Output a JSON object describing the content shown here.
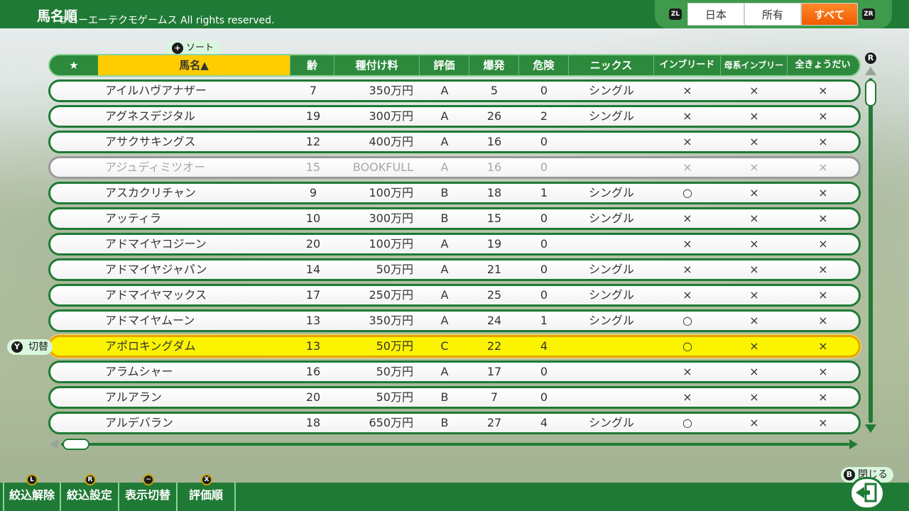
{
  "topbar": {
    "title": "馬名順",
    "copyright": "©コーエーテクモゲームス All rights reserved.",
    "zl_label": "ZL",
    "zr_label": "ZR",
    "filters": [
      {
        "label": "日本",
        "active": false
      },
      {
        "label": "所有",
        "active": false
      },
      {
        "label": "すべて",
        "active": true
      }
    ]
  },
  "sort_hint": {
    "button": "+",
    "label": "ソート"
  },
  "table": {
    "headers": {
      "star": "★",
      "name": "馬名▲",
      "age": "齢",
      "fee": "種付け料",
      "eval": "評価",
      "boom": "爆発",
      "risk": "危険",
      "nicks": "ニックス",
      "inbreed": "インブリード",
      "dam_inbreed": "母系インブリード",
      "siblings": "全きょうだい"
    },
    "rows": [
      {
        "name": "アイルハヴアナザー",
        "age": "7",
        "fee": "350万円",
        "eval": "A",
        "boom": "5",
        "risk": "0",
        "nicks": "シングル",
        "inbreed": "×",
        "dam_inbreed": "×",
        "siblings": "×"
      },
      {
        "name": "アグネスデジタル",
        "age": "19",
        "fee": "300万円",
        "eval": "A",
        "boom": "26",
        "risk": "2",
        "nicks": "シングル",
        "inbreed": "×",
        "dam_inbreed": "×",
        "siblings": "×"
      },
      {
        "name": "アサクサキングス",
        "age": "12",
        "fee": "400万円",
        "eval": "A",
        "boom": "16",
        "risk": "0",
        "nicks": "",
        "inbreed": "×",
        "dam_inbreed": "×",
        "siblings": "×"
      },
      {
        "name": "アジュディミツオー",
        "age": "15",
        "fee": "BOOKFULL",
        "eval": "A",
        "boom": "16",
        "risk": "0",
        "nicks": "",
        "inbreed": "×",
        "dam_inbreed": "×",
        "siblings": "×",
        "disabled": true
      },
      {
        "name": "アスカクリチャン",
        "age": "9",
        "fee": "100万円",
        "eval": "B",
        "boom": "18",
        "risk": "1",
        "nicks": "シングル",
        "inbreed": "○",
        "dam_inbreed": "×",
        "siblings": "×"
      },
      {
        "name": "アッティラ",
        "age": "10",
        "fee": "300万円",
        "eval": "B",
        "boom": "15",
        "risk": "0",
        "nicks": "シングル",
        "inbreed": "×",
        "dam_inbreed": "×",
        "siblings": "×"
      },
      {
        "name": "アドマイヤコジーン",
        "age": "20",
        "fee": "100万円",
        "eval": "A",
        "boom": "19",
        "risk": "0",
        "nicks": "",
        "inbreed": "×",
        "dam_inbreed": "×",
        "siblings": "×"
      },
      {
        "name": "アドマイヤジャパン",
        "age": "14",
        "fee": "50万円",
        "eval": "A",
        "boom": "21",
        "risk": "0",
        "nicks": "シングル",
        "inbreed": "×",
        "dam_inbreed": "×",
        "siblings": "×"
      },
      {
        "name": "アドマイヤマックス",
        "age": "17",
        "fee": "250万円",
        "eval": "A",
        "boom": "25",
        "risk": "0",
        "nicks": "シングル",
        "inbreed": "×",
        "dam_inbreed": "×",
        "siblings": "×"
      },
      {
        "name": "アドマイヤムーン",
        "age": "13",
        "fee": "350万円",
        "eval": "A",
        "boom": "24",
        "risk": "1",
        "nicks": "シングル",
        "inbreed": "○",
        "dam_inbreed": "×",
        "siblings": "×"
      },
      {
        "name": "アポロキングダム",
        "age": "13",
        "fee": "50万円",
        "eval": "C",
        "boom": "22",
        "risk": "4",
        "nicks": "",
        "inbreed": "○",
        "dam_inbreed": "×",
        "siblings": "×",
        "selected": true
      },
      {
        "name": "アラムシャー",
        "age": "16",
        "fee": "50万円",
        "eval": "A",
        "boom": "17",
        "risk": "0",
        "nicks": "",
        "inbreed": "×",
        "dam_inbreed": "×",
        "siblings": "×"
      },
      {
        "name": "アルアラン",
        "age": "20",
        "fee": "50万円",
        "eval": "B",
        "boom": "7",
        "risk": "0",
        "nicks": "",
        "inbreed": "×",
        "dam_inbreed": "×",
        "siblings": "×"
      },
      {
        "name": "アルデバラン",
        "age": "18",
        "fee": "650万円",
        "eval": "B",
        "boom": "27",
        "risk": "4",
        "nicks": "シングル",
        "inbreed": "○",
        "dam_inbreed": "×",
        "siblings": "×"
      }
    ]
  },
  "toggle_hint": {
    "button": "Y",
    "label": "切替"
  },
  "scroll": {
    "r_button": "R"
  },
  "bottombar": {
    "buttons": [
      {
        "icon": "L",
        "label": "絞込解除"
      },
      {
        "icon": "R",
        "label": "絞込設定"
      },
      {
        "icon": "−",
        "label": "表示切替"
      },
      {
        "icon": "X",
        "label": "評価順"
      }
    ],
    "close_button": "B",
    "close_label": "閉じる"
  },
  "colors": {
    "accent_green": "#1f7a35",
    "highlight_yellow": "#fbf300",
    "active_tab_orange": "#f05a00"
  }
}
